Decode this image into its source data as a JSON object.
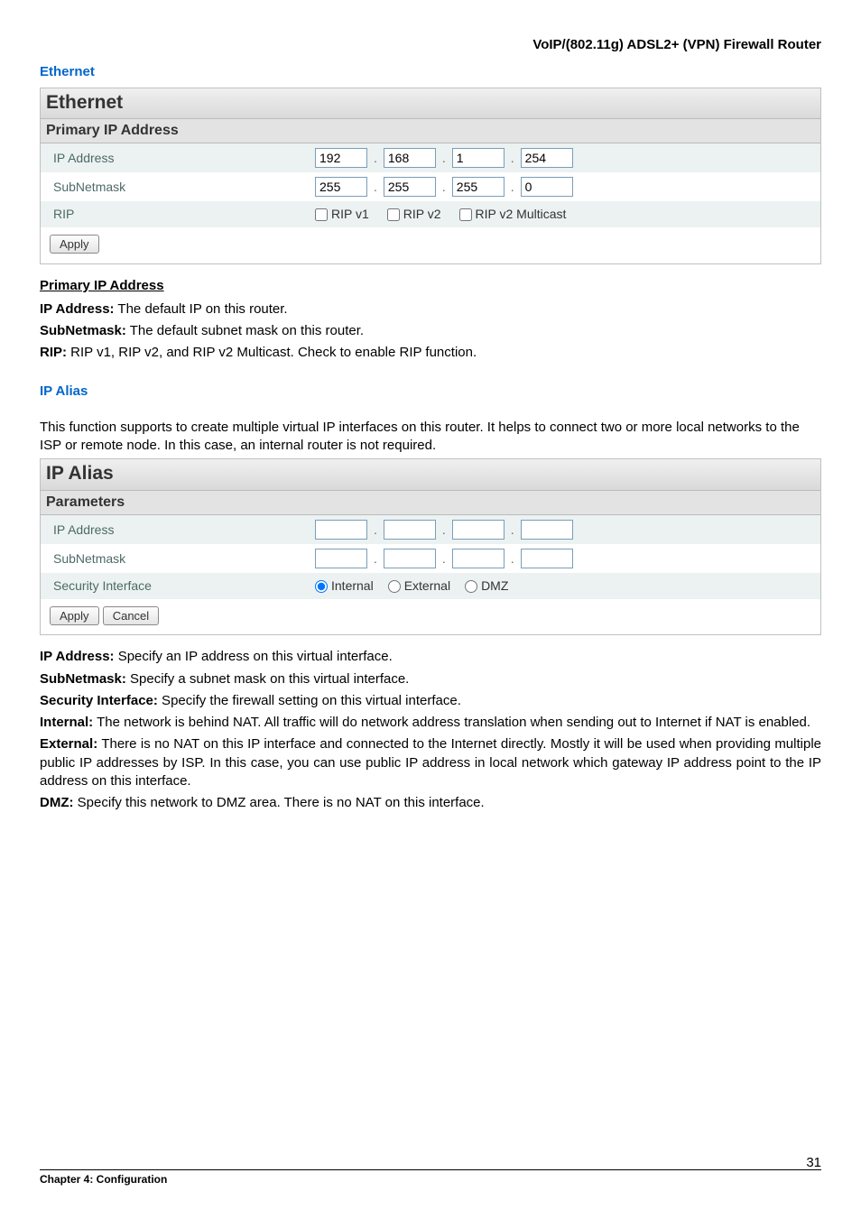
{
  "header": {
    "title": "VoIP/(802.11g) ADSL2+ (VPN) Firewall Router"
  },
  "sec1": {
    "heading": "Ethernet",
    "panel": {
      "title": "Ethernet",
      "subtitle": "Primary IP Address",
      "row_ip_label": "IP Address",
      "row_mask_label": "SubNetmask",
      "row_rip_label": "RIP",
      "ip": {
        "o1": "192",
        "o2": "168",
        "o3": "1",
        "o4": "254"
      },
      "mask": {
        "o1": "255",
        "o2": "255",
        "o3": "255",
        "o4": "0"
      },
      "rip": {
        "v1": "RIP v1",
        "v2": "RIP v2",
        "v2m": "RIP v2 Multicast"
      },
      "apply": "Apply"
    },
    "u_heading": "Primary IP Address",
    "p1_b": "IP Address:",
    "p1_t": " The default IP on this router.",
    "p2_b": "SubNetmask:",
    "p2_t": " The default subnet mask on this router.",
    "p3_b": "RIP:",
    "p3_t": " RIP v1, RIP v2, and RIP v2 Multicast.    Check to enable RIP function."
  },
  "sec2": {
    "heading": "IP Alias",
    "intro": "This function supports to create multiple virtual IP interfaces on this router. It helps to connect two or more local networks to the ISP or remote node. In this case, an internal router is not required.",
    "panel": {
      "title": "IP Alias",
      "subtitle": "Parameters",
      "row_ip_label": "IP Address",
      "row_mask_label": "SubNetmask",
      "row_sec_label": "Security Interface",
      "opt_int": "Internal",
      "opt_ext": "External",
      "opt_dmz": "DMZ",
      "apply": "Apply",
      "cancel": "Cancel"
    },
    "p1_b": "IP Address:",
    "p1_t": " Specify an IP address on this virtual interface.",
    "p2_b": "SubNetmask:",
    "p2_t": " Specify a subnet mask on this virtual interface.",
    "p3_b": "Security Interface:",
    "p3_t": " Specify the firewall setting on this virtual interface.",
    "p4_b": "Internal:",
    "p4_t": " The network is behind NAT. All traffic will do network address translation when sending out to Internet if NAT is enabled.",
    "p5_b": "External:",
    "p5_t": " There is no NAT on this IP interface and connected to the Internet directly. Mostly it will be used when providing multiple public IP addresses by ISP. In this case, you can use public IP address in local network which gateway IP address point to the IP address on this interface.",
    "p6_b": "DMZ:",
    "p6_t": " Specify this network to DMZ area. There is no NAT on this interface."
  },
  "footer": {
    "chapter": "Chapter 4: Configuration",
    "page": "31"
  }
}
